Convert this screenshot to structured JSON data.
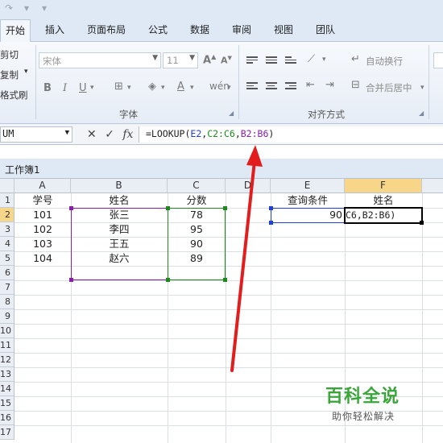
{
  "ribbon_tabs": [
    "开始",
    "插入",
    "页面布局",
    "公式",
    "数据",
    "审阅",
    "视图",
    "团队"
  ],
  "ribbon": {
    "clipboard": [
      "剪切",
      "复制",
      "格式刷"
    ],
    "font_name": "宋体",
    "font_size": "11",
    "font_group_label": "字体",
    "align_group_label": "对齐方式",
    "wrap_text": "自动换行",
    "merge_center": "合并后居中"
  },
  "formula_bar": {
    "name_box": "UM",
    "cancel_glyph": "✕",
    "enter_glyph": "✓",
    "fx_glyph": "fx",
    "formula_prefix": "=LOOKUP(",
    "ref1": "E2",
    "sep1": ",",
    "ref2": "C2:C6",
    "sep2": ",",
    "ref3": "B2:B6",
    "formula_suffix": ")"
  },
  "workbook_title": "工作簿1",
  "columns": [
    "A",
    "B",
    "C",
    "D",
    "E",
    "F"
  ],
  "row_numbers": [
    "1",
    "2",
    "3",
    "4",
    "5",
    "6",
    "7",
    "8",
    "9",
    "10",
    "11",
    "12",
    "13",
    "14",
    "15",
    "16",
    "17"
  ],
  "headers": {
    "a1": "学号",
    "b1": "姓名",
    "c1": "分数",
    "e1": "查询条件",
    "f1": "姓名"
  },
  "table": [
    {
      "id": "101",
      "name": "张三",
      "score": "78"
    },
    {
      "id": "102",
      "name": "李四",
      "score": "95"
    },
    {
      "id": "103",
      "name": "王五",
      "score": "90"
    },
    {
      "id": "104",
      "name": "赵六",
      "score": "89"
    }
  ],
  "e2": "90",
  "f2_edit": "C6,B2:B6)",
  "watermark": {
    "title": "百科全说",
    "subtitle": "助你轻松解决"
  },
  "colors": {
    "ref_e": "#1f3fd8",
    "ref_c": "#1d8a1d",
    "ref_b": "#8a1dae",
    "arrow": "#e21d1d",
    "selected_header": "#f7d68a",
    "watermark_green": "#3aa63a"
  }
}
